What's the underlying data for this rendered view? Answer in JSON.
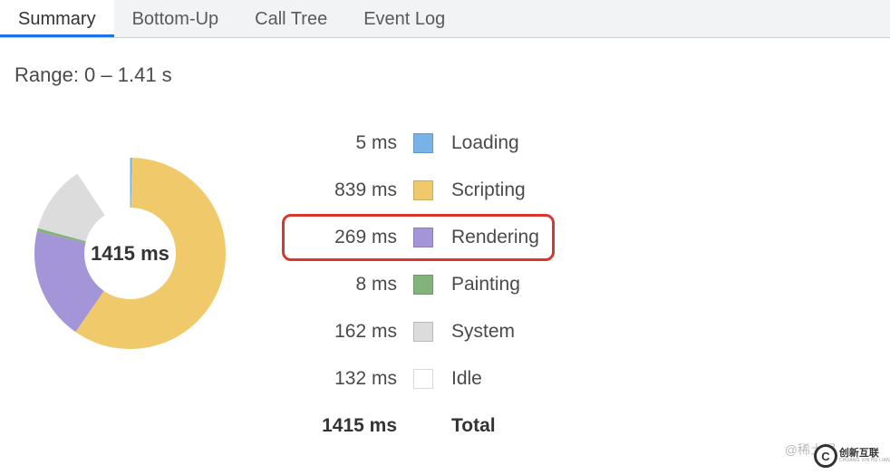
{
  "tabs": {
    "items": [
      {
        "label": "Summary",
        "active": true
      },
      {
        "label": "Bottom-Up",
        "active": false
      },
      {
        "label": "Call Tree",
        "active": false
      },
      {
        "label": "Event Log",
        "active": false
      }
    ]
  },
  "range_text": "Range: 0 – 1.41 s",
  "center_total": "1415 ms",
  "legend": {
    "rows": [
      {
        "value": "5 ms",
        "label": "Loading",
        "color": "#77b3e6",
        "highlighted": false,
        "ms": 5
      },
      {
        "value": "839 ms",
        "label": "Scripting",
        "color": "#f0c96b",
        "highlighted": false,
        "ms": 839
      },
      {
        "value": "269 ms",
        "label": "Rendering",
        "color": "#a395d7",
        "highlighted": true,
        "ms": 269
      },
      {
        "value": "8 ms",
        "label": "Painting",
        "color": "#81b37b",
        "highlighted": false,
        "ms": 8
      },
      {
        "value": "162 ms",
        "label": "System",
        "color": "#dcdcdc",
        "highlighted": false,
        "ms": 162
      },
      {
        "value": "132 ms",
        "label": "Idle",
        "color": "#ffffff",
        "highlighted": false,
        "ms": 132
      }
    ],
    "total_value": "1415 ms",
    "total_label": "Total"
  },
  "signature": "@稀土掘",
  "watermark": {
    "initials": "C",
    "line1": "创新互联",
    "line2": "CHUANG XIN HU LIAN"
  },
  "chart_data": {
    "type": "pie",
    "title": "",
    "categories": [
      "Loading",
      "Scripting",
      "Rendering",
      "Painting",
      "System",
      "Idle"
    ],
    "values": [
      5,
      839,
      269,
      8,
      162,
      132
    ],
    "colors": [
      "#77b3e6",
      "#f0c96b",
      "#a395d7",
      "#81b37b",
      "#dcdcdc",
      "#ffffff"
    ],
    "total": 1415,
    "unit": "ms"
  }
}
